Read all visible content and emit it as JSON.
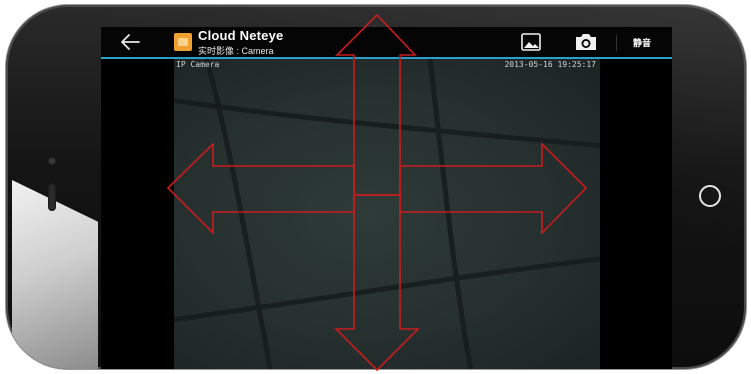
{
  "app": {
    "title": "Cloud Neteye",
    "subtitle": "实时影像 : Camera",
    "accent_color": "#2aa0c8",
    "icon": "cloud-neteye-app-icon"
  },
  "toolbar": {
    "back_icon": "back-arrow-icon",
    "gallery_icon": "gallery-icon",
    "camera_icon": "camera-icon",
    "mute_label": "静音"
  },
  "video": {
    "osd_label": "IP Camera",
    "timestamp": "2013-05-16 19:25:17"
  },
  "controls": {
    "arrow_color": "#c81c1c",
    "arrows": [
      "up-arrow",
      "down-arrow",
      "left-arrow",
      "right-arrow"
    ]
  },
  "device": {
    "home_button_icon": "home-button-icon"
  }
}
